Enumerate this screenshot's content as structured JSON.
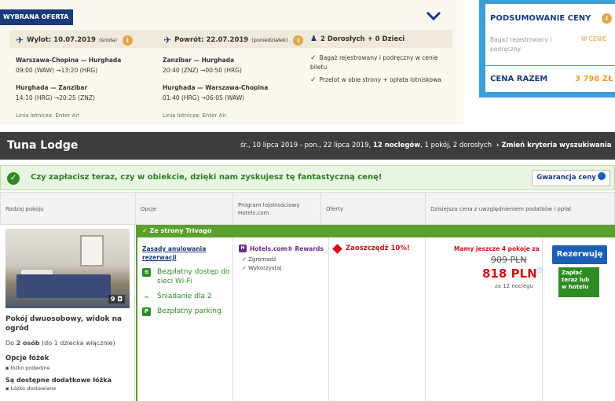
{
  "offer": {
    "tag": "WYBRANA OFERTA",
    "outbound": {
      "head": "Wylot: 10.07.2019",
      "day": "(środa)",
      "leg1_route": "Warszawa-Chopina — Hurghada",
      "leg1_time": "09:00 (WAW) →13:20 (HRG)",
      "leg2_route": "Hurghada — Zanzibar",
      "leg2_time": "14:10 (HRG) →20:25 (ZNZ)",
      "airline": "Linia lotnicza: Enter Air"
    },
    "return": {
      "head": "Powrót: 22.07.2019",
      "day": "(poniedziałek)",
      "leg1_route": "Zanzibar — Hurghada",
      "leg1_time": "20:40 (ZNZ) →00:50 (HRG)",
      "leg2_route": "Hurghada — Warszawa-Chopina",
      "leg2_time": "01:40 (HRG) →06:05 (WAW)",
      "airline": "Linia lotnicza: Enter Air"
    },
    "passengers": "2 Dorosłych + 0 Dzieci",
    "includes": [
      "Bagaż rejestrowany i podręczny w cenie biletu",
      "Przelot w obie strony + opłata lotniskowa"
    ]
  },
  "summary": {
    "title": "PODSUMOWANIE CENY",
    "bag_label": "Bagaż rejestrowany i podręczny",
    "bag_value": "W CENIE",
    "total_label": "CENA RAZEM",
    "total_value": "3 798 ZŁ"
  },
  "hotel": {
    "name": "Tuna Lodge",
    "dates_pre": "śr., 10 lipca 2019 - pon., 22 lipca 2019,",
    "nights_bold": "12 noclegów",
    "dates_post": ", 1 pokój, 2 dorosłych",
    "change": "› Zmień kryteria wyszukiwania"
  },
  "banner": {
    "text": "Czy zapłacisz teraz, czy w obiekcie, dzięki nam zyskujesz tę fantastyczną cenę!",
    "button": "Gwarancja ceny"
  },
  "table_headers": [
    "Rodzaj pokoju",
    "Opcje",
    "Program lojalnościowy Hotels.com",
    "Oferty",
    "Dzisiejsza cena z uwzględnieniem podatków i opłat"
  ],
  "room": {
    "photo_count": "9",
    "name": "Pokój dwuosobowy, widok na ogród",
    "occupancy_bold": "2 osób",
    "occupancy_pre": "Do",
    "occupancy_post": "(do 1 dziecka włącznie)",
    "beds_title": "Opcje łóżek",
    "beds_item": "łóżko podwójne",
    "extra_title": "Są dostępne dodatkowe łóżka",
    "extra_item": "Łóżko dostawiane"
  },
  "rate": {
    "source": "Ze strony Trivago",
    "cancel": "Zasady anulowania rezerwacji",
    "options": [
      {
        "icon": "wifi",
        "label": "Bezpłatny dostęp do sieci Wi-Fi"
      },
      {
        "icon": "breakfast",
        "label": "Śniadanie dla 2"
      },
      {
        "icon": "P",
        "label": "Bezpłatny parking"
      }
    ],
    "loyalty_title": "Hotels.com® Rewards",
    "loyalty_items": [
      "Zgromadź",
      "Wykorzystaj"
    ],
    "deal": "Zaoszczędź 10%!",
    "rooms_left": "Mamy jeszcze 4 pokoje za",
    "old_price": "909 PLN",
    "new_price": "818 PLN",
    "per_nights": "za 12 noclegu",
    "reserve": "Rezerwuję",
    "pay_later": "Zapłać teraz lub w hotelu"
  }
}
